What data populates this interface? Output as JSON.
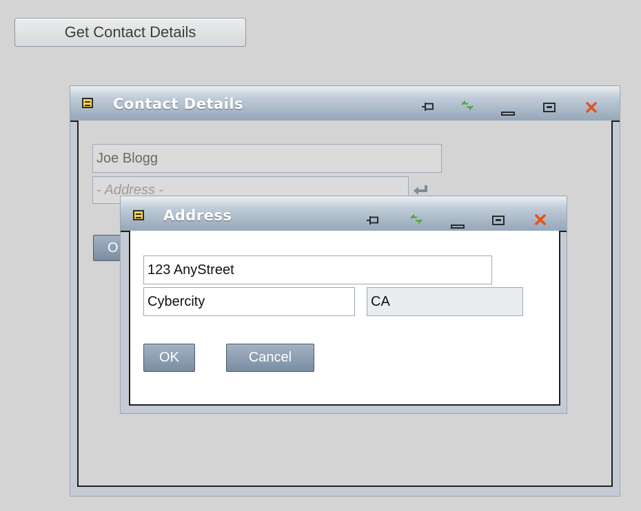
{
  "top_button": {
    "label": "Get Contact Details"
  },
  "contact_window": {
    "title": "Contact Details",
    "name_value": "Joe Blogg",
    "address_placeholder": "- Address -",
    "ok_partial_label": "O"
  },
  "address_window": {
    "title": "Address",
    "street_value": "123 AnyStreet",
    "city_value": "Cybercity",
    "state_value": "CA",
    "ok_label": "OK",
    "cancel_label": "Cancel"
  },
  "icons": {
    "window_icon": "note-icon",
    "pin": "pin-icon",
    "refresh": "refresh-icon",
    "minimize": "minimize-icon",
    "maximize": "maximize-icon",
    "close": "close-icon",
    "enter": "enter-icon"
  },
  "colors": {
    "background": "#d4d4d4",
    "titlebar_top": "#e9eef3",
    "titlebar_bottom": "#95a7b9",
    "close_x": "#e8501a",
    "refresh_green": "#4aa32c",
    "note_yellow": "#ffd54a",
    "button_blue": "#8a9cb0"
  }
}
